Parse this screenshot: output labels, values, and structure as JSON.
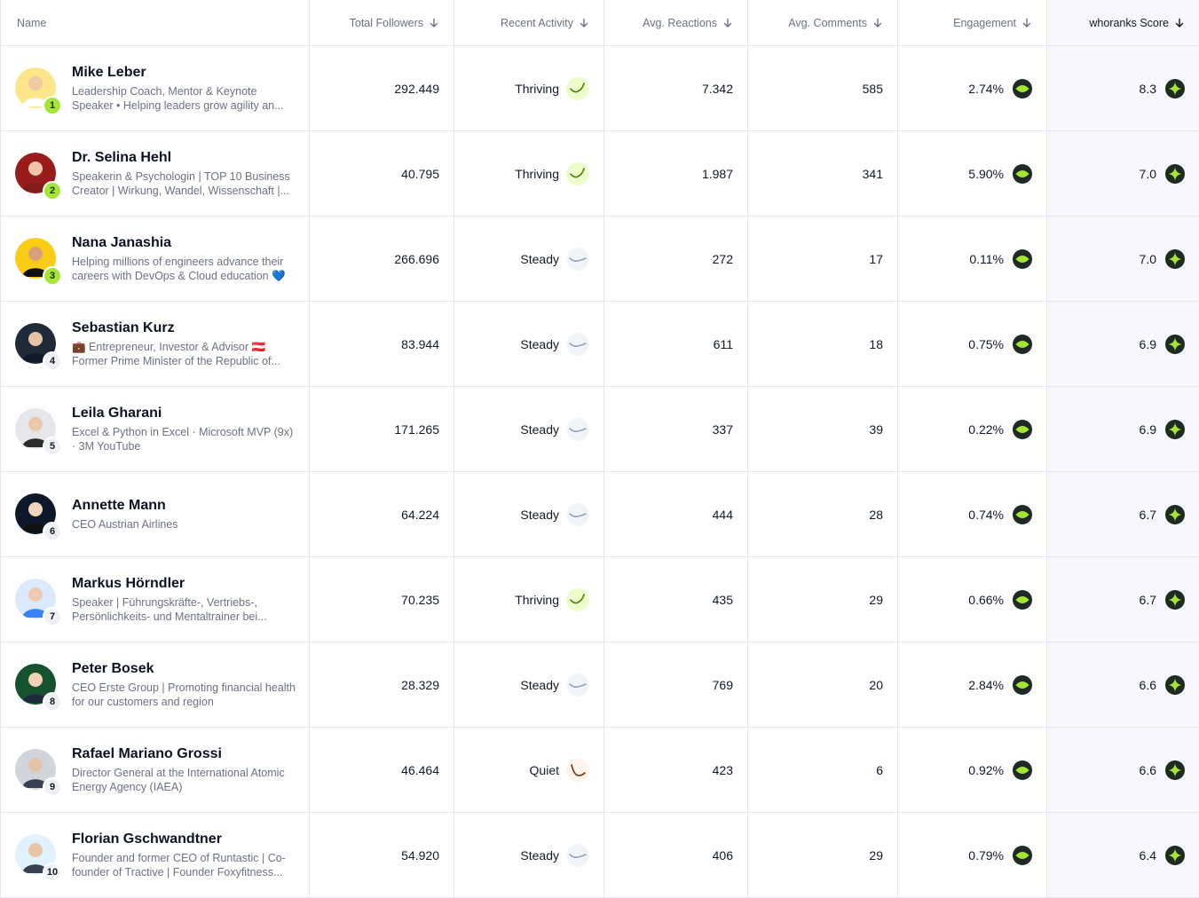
{
  "headers": {
    "name": "Name",
    "followers": "Total Followers",
    "activity": "Recent Activity",
    "reactions": "Avg. Reactions",
    "comments": "Avg. Comments",
    "engagement": "Engagement",
    "score": "whoranks Score"
  },
  "colors": {
    "thriving": "#4d7c0f",
    "steady": "#94a3b8",
    "quiet": "#7c2d12",
    "badge_dark": "#1f2a24",
    "badge_green": "#a3e635"
  },
  "rows": [
    {
      "rank": "1",
      "name": "Mike Leber",
      "desc": "Leadership Coach, Mentor & Keynote Speaker • Helping leaders grow agility an...",
      "followers": "292.449",
      "activity": "Thriving",
      "reactions": "7.342",
      "comments": "585",
      "engagement": "2.74%",
      "score": "8.3"
    },
    {
      "rank": "2",
      "name": "Dr. Selina Hehl",
      "desc": "Speakerin & Psychologin | TOP 10 Business Creator | Wirkung, Wandel, Wissenschaft |...",
      "followers": "40.795",
      "activity": "Thriving",
      "reactions": "1.987",
      "comments": "341",
      "engagement": "5.90%",
      "score": "7.0"
    },
    {
      "rank": "3",
      "name": "Nana Janashia",
      "desc": "Helping millions of engineers advance their careers with DevOps & Cloud education 💙",
      "followers": "266.696",
      "activity": "Steady",
      "reactions": "272",
      "comments": "17",
      "engagement": "0.11%",
      "score": "7.0"
    },
    {
      "rank": "4",
      "name": "Sebastian Kurz",
      "desc": "💼 Entrepreneur, Investor & Advisor 🇦🇹 Former Prime Minister of the Republic of...",
      "followers": "83.944",
      "activity": "Steady",
      "reactions": "611",
      "comments": "18",
      "engagement": "0.75%",
      "score": "6.9"
    },
    {
      "rank": "5",
      "name": "Leila Gharani",
      "desc": "Excel & Python in Excel · Microsoft MVP (9x) · 3M YouTube",
      "followers": "171.265",
      "activity": "Steady",
      "reactions": "337",
      "comments": "39",
      "engagement": "0.22%",
      "score": "6.9"
    },
    {
      "rank": "6",
      "name": "Annette Mann",
      "desc": "CEO Austrian Airlines",
      "followers": "64.224",
      "activity": "Steady",
      "reactions": "444",
      "comments": "28",
      "engagement": "0.74%",
      "score": "6.7"
    },
    {
      "rank": "7",
      "name": "Markus Hörndler",
      "desc": "Speaker | Führungskräfte-, Vertriebs-, Persönlichkeits- und Mentaltrainer bei...",
      "followers": "70.235",
      "activity": "Thriving",
      "reactions": "435",
      "comments": "29",
      "engagement": "0.66%",
      "score": "6.7"
    },
    {
      "rank": "8",
      "name": "Peter Bosek",
      "desc": "CEO Erste Group | Promoting financial health for our customers and region",
      "followers": "28.329",
      "activity": "Steady",
      "reactions": "769",
      "comments": "20",
      "engagement": "2.84%",
      "score": "6.6"
    },
    {
      "rank": "9",
      "name": "Rafael Mariano Grossi",
      "desc": "Director General at the International Atomic Energy Agency (IAEA)",
      "followers": "46.464",
      "activity": "Quiet",
      "reactions": "423",
      "comments": "6",
      "engagement": "0.92%",
      "score": "6.6"
    },
    {
      "rank": "10",
      "name": "Florian Gschwandtner",
      "desc": "Founder and former CEO of Runtastic | Co-founder of Tractive | Founder Foxyfitness...",
      "followers": "54.920",
      "activity": "Steady",
      "reactions": "406",
      "comments": "29",
      "engagement": "0.79%",
      "score": "6.4"
    }
  ]
}
